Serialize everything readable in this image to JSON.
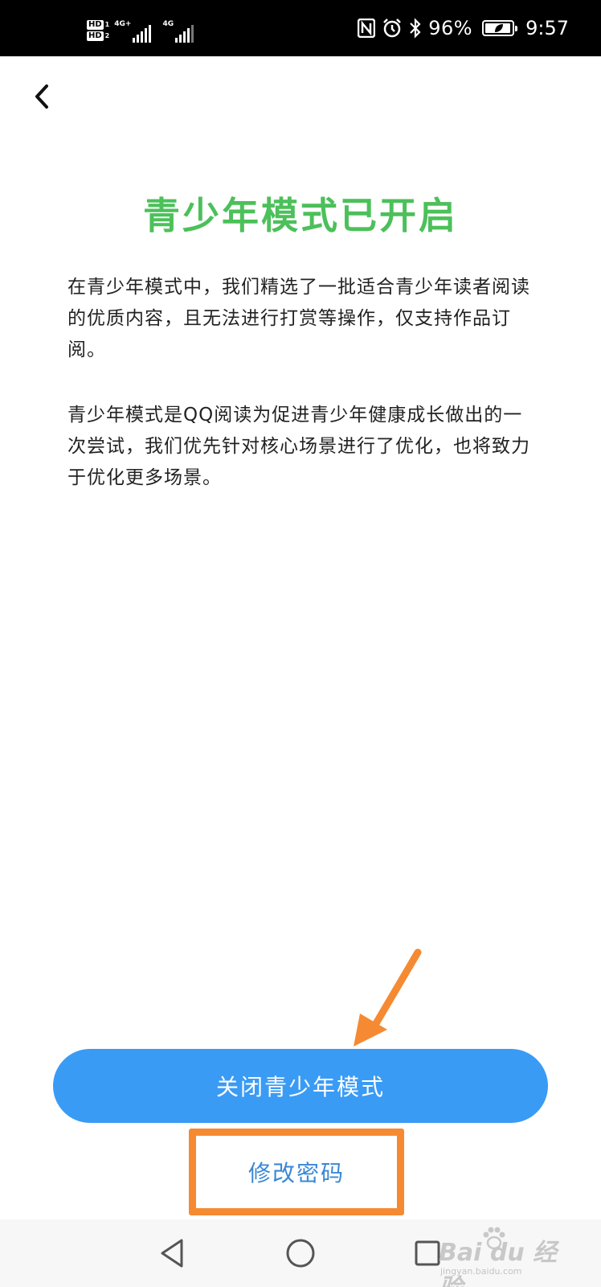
{
  "status_bar": {
    "sim1_badge": "HD",
    "sim1_index": "1",
    "sim2_badge": "HD",
    "sim2_index": "2",
    "network1": "4G+",
    "network2": "4G",
    "battery_percent": "96%",
    "battery_level": 0.96,
    "time": "9:57",
    "icons": [
      "nfc-icon",
      "alarm-icon",
      "bluetooth-icon",
      "battery-icon"
    ]
  },
  "header": {
    "back_icon": "chevron-left-icon"
  },
  "content": {
    "title": "青少年模式已开启",
    "paragraph1": "在青少年模式中，我们精选了一批适合青少年读者阅读的优质内容，且无法进行打赏等操作，仅支持作品订阅。",
    "paragraph2": "青少年模式是QQ阅读为促进青少年健康成长做出的一次尝试，我们优先针对核心场景进行了优化，也将致力于优化更多场景。"
  },
  "actions": {
    "close_mode_label": "关闭青少年模式",
    "change_password_label": "修改密码"
  },
  "navigation": {
    "icons": [
      "back-triangle-icon",
      "home-circle-icon",
      "recent-apps-square-icon"
    ]
  },
  "watermark": {
    "main": "Bai du 经验",
    "sub": "jingyan.baidu.com"
  },
  "colors": {
    "title_green": "#4cc05a",
    "primary_blue": "#3a9bf5",
    "link_blue": "#3a87d4",
    "annotation_orange": "#f58a33"
  }
}
